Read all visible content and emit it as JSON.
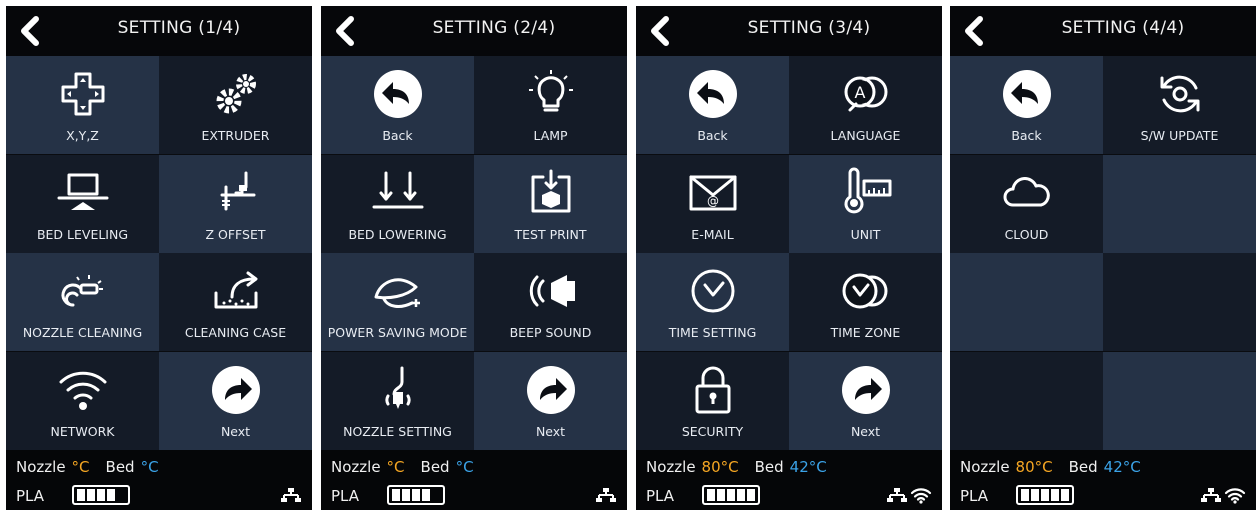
{
  "colors": {
    "accent_nozzle": "#f5a623",
    "accent_bed": "#3ba3e8",
    "panel_bg": "#0a0c10",
    "cell_dark": "#141b27",
    "cell_light": "#253246",
    "text": "#e8ecf2"
  },
  "screens": [
    {
      "title": "SETTING (1/4)",
      "cells": [
        {
          "label": "X,Y,Z",
          "icon": "dpad-icon"
        },
        {
          "label": "EXTRUDER",
          "icon": "gears-icon"
        },
        {
          "label": "BED LEVELING",
          "icon": "bed-leveling-icon"
        },
        {
          "label": "Z OFFSET",
          "icon": "z-offset-icon"
        },
        {
          "label": "NOZZLE CLEANING",
          "icon": "nozzle-cleaning-icon"
        },
        {
          "label": "CLEANING CASE",
          "icon": "cleaning-case-icon"
        },
        {
          "label": "NETWORK",
          "icon": "wifi-icon"
        },
        {
          "label": "Next",
          "icon": "next-arrow-icon"
        }
      ],
      "status": {
        "nozzle_label": "Nozzle",
        "nozzle_value": "°C",
        "bed_label": "Bed",
        "bed_value": "°C",
        "material": "PLA",
        "battery_bars": 4,
        "icons": [
          "ethernet-icon"
        ]
      }
    },
    {
      "title": "SETTING (2/4)",
      "cells": [
        {
          "label": "Back",
          "icon": "back-arrow-icon"
        },
        {
          "label": "LAMP",
          "icon": "lamp-icon"
        },
        {
          "label": "BED LOWERING",
          "icon": "bed-lowering-icon"
        },
        {
          "label": "TEST PRINT",
          "icon": "test-print-icon"
        },
        {
          "label": "POWER SAVING MODE",
          "icon": "power-saving-icon"
        },
        {
          "label": "BEEP SOUND",
          "icon": "speaker-icon"
        },
        {
          "label": "NOZZLE SETTING",
          "icon": "nozzle-setting-icon"
        },
        {
          "label": "Next",
          "icon": "next-arrow-icon"
        }
      ],
      "status": {
        "nozzle_label": "Nozzle",
        "nozzle_value": "°C",
        "bed_label": "Bed",
        "bed_value": "°C",
        "material": "PLA",
        "battery_bars": 4,
        "icons": [
          "ethernet-icon"
        ]
      }
    },
    {
      "title": "SETTING (3/4)",
      "cells": [
        {
          "label": "Back",
          "icon": "back-arrow-icon"
        },
        {
          "label": "LANGUAGE",
          "icon": "language-icon"
        },
        {
          "label": "E-MAIL",
          "icon": "email-icon"
        },
        {
          "label": "UNIT",
          "icon": "unit-icon"
        },
        {
          "label": "TIME SETTING",
          "icon": "clock-icon"
        },
        {
          "label": "TIME ZONE",
          "icon": "time-zone-icon"
        },
        {
          "label": "SECURITY",
          "icon": "lock-icon"
        },
        {
          "label": "Next",
          "icon": "next-arrow-icon"
        }
      ],
      "status": {
        "nozzle_label": "Nozzle",
        "nozzle_value": "80°C",
        "bed_label": "Bed",
        "bed_value": "42°C",
        "material": "PLA",
        "battery_bars": 5,
        "icons": [
          "ethernet-icon",
          "wifi-icon"
        ]
      }
    },
    {
      "title": "SETTING (4/4)",
      "cells": [
        {
          "label": "Back",
          "icon": "back-arrow-icon"
        },
        {
          "label": "S/W UPDATE",
          "icon": "sw-update-icon"
        },
        {
          "label": "CLOUD",
          "icon": "cloud-icon"
        },
        {
          "label": "",
          "icon": ""
        },
        {
          "label": "",
          "icon": ""
        },
        {
          "label": "",
          "icon": ""
        },
        {
          "label": "",
          "icon": ""
        },
        {
          "label": "",
          "icon": ""
        }
      ],
      "status": {
        "nozzle_label": "Nozzle",
        "nozzle_value": "80°C",
        "bed_label": "Bed",
        "bed_value": "42°C",
        "material": "PLA",
        "battery_bars": 5,
        "icons": [
          "ethernet-icon",
          "wifi-icon"
        ]
      }
    }
  ]
}
